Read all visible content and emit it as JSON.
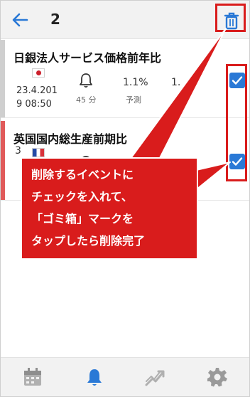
{
  "header": {
    "selected_count": "2",
    "back_icon": "arrow-left-icon",
    "delete_icon": "trash-icon"
  },
  "events": [
    {
      "title": "日銀法人サービス価格前年比",
      "country": "Japan",
      "flag_icon": "japan-flag-icon",
      "date_line1": "23.4.201",
      "date_line2": "9 08:50",
      "alert_minutes": "45 分",
      "forecast_value": "1.1%",
      "forecast_label": "予測",
      "extra_value": "1.",
      "checked": true
    },
    {
      "title": "英国国内総生産前期比",
      "country": "France",
      "flag_icon": "france-flag-icon",
      "date_partial": "3",
      "checked": true
    }
  ],
  "callout": {
    "line1": "削除するイベントに",
    "line2": "チェックを入れて、",
    "line3": "「ゴミ箱」マークを",
    "line4": "タップしたら削除完了"
  },
  "bottom_nav": {
    "items": [
      "calendar-icon",
      "bell-icon",
      "trend-icon",
      "gear-icon"
    ],
    "active": "bell-icon"
  },
  "colors": {
    "accent": "#2a79d6",
    "annotation_red": "#d91c1c",
    "callout_fill": "#d91c1c",
    "stripe_red": "#e05a5a"
  }
}
